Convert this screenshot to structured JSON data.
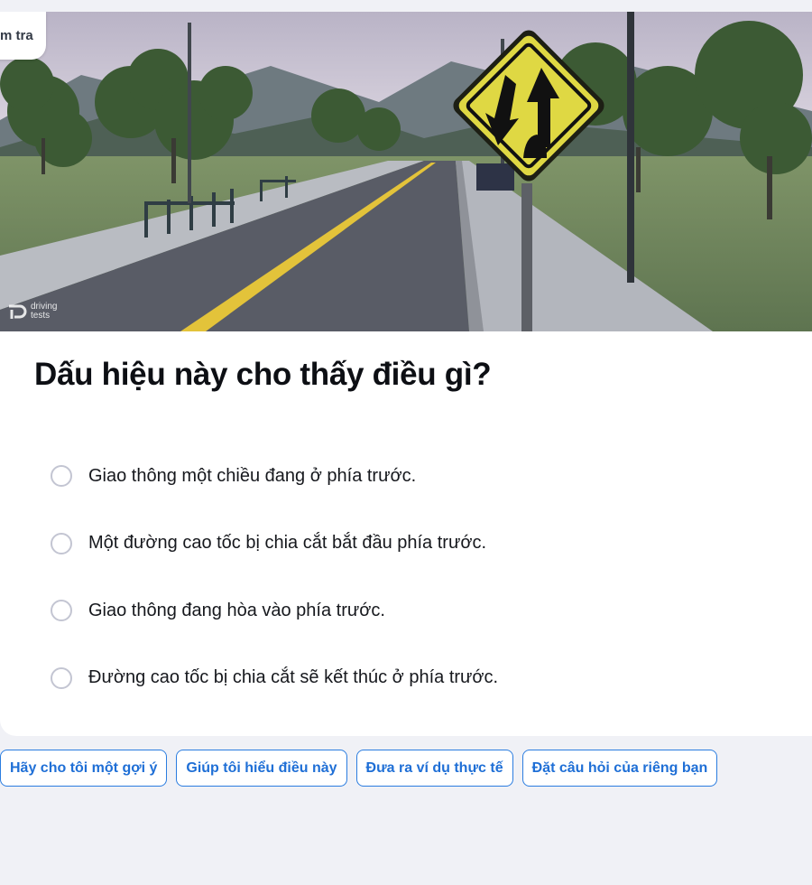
{
  "app": {
    "accent_color": "#1f6fd6",
    "background_color": "#f0f1f6"
  },
  "header_tag": {
    "label": "m tra"
  },
  "image": {
    "description_icons": [
      "divided-highway-sign",
      "road",
      "trees"
    ],
    "watermark_top": "driving",
    "watermark_bottom": "tests"
  },
  "question": {
    "text": "Dấu hiệu này cho thấy điều gì?",
    "options": [
      {
        "label": "Giao thông một chiều đang ở phía trước."
      },
      {
        "label": "Một đường cao tốc bị chia cắt bắt đầu phía trước."
      },
      {
        "label": "Giao thông đang hòa vào phía trước."
      },
      {
        "label": "Đường cao tốc bị chia cắt sẽ kết thúc ở phía trước."
      }
    ]
  },
  "suggestions": [
    {
      "label": "Hãy cho tôi một gợi ý"
    },
    {
      "label": "Giúp tôi hiểu điều này"
    },
    {
      "label": "Đưa ra ví dụ thực tế"
    },
    {
      "label": "Đặt câu hỏi của riêng bạn"
    }
  ]
}
